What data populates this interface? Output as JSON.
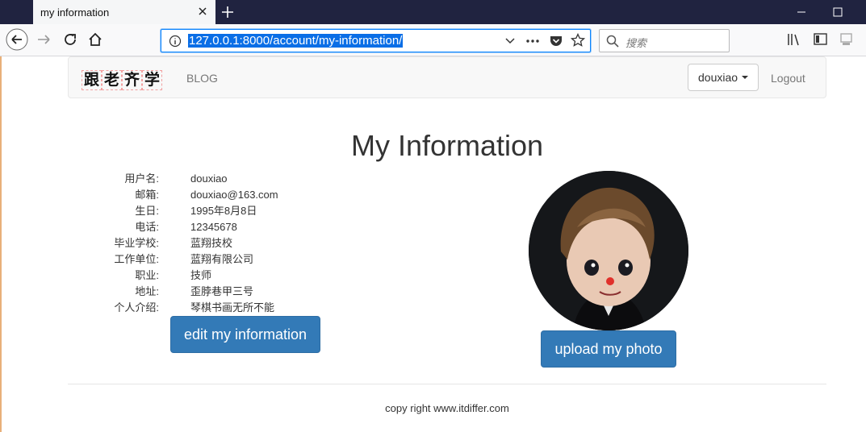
{
  "browser": {
    "tab_title": "my information",
    "url": "127.0.0.1:8000/account/my-information/",
    "search_placeholder": "搜索"
  },
  "site": {
    "brand_chars": [
      "跟",
      "老",
      "齐",
      "学"
    ],
    "nav_blog": "BLOG",
    "user_menu": "douxiao",
    "logout": "Logout"
  },
  "page": {
    "title": "My Information",
    "fields": [
      {
        "label": "用户名:",
        "value": "douxiao"
      },
      {
        "label": "邮箱:",
        "value": "douxiao@163.com"
      },
      {
        "label": "生日:",
        "value": "1995年8月8日"
      },
      {
        "label": "电话:",
        "value": "12345678"
      },
      {
        "label": "毕业学校:",
        "value": "蓝翔技校"
      },
      {
        "label": "工作单位:",
        "value": "蓝翔有限公司"
      },
      {
        "label": "职业:",
        "value": "技师"
      },
      {
        "label": "地址:",
        "value": "歪脖巷甲三号"
      },
      {
        "label": "个人介绍:",
        "value": "琴棋书画无所不能"
      }
    ],
    "edit_button": "edit my information",
    "upload_button": "upload my photo"
  },
  "footer": {
    "text": "copy right www.itdiffer.com"
  },
  "colors": {
    "primary": "#337ab7",
    "titlebar": "#202340",
    "url_highlight": "#0a6ee6"
  }
}
